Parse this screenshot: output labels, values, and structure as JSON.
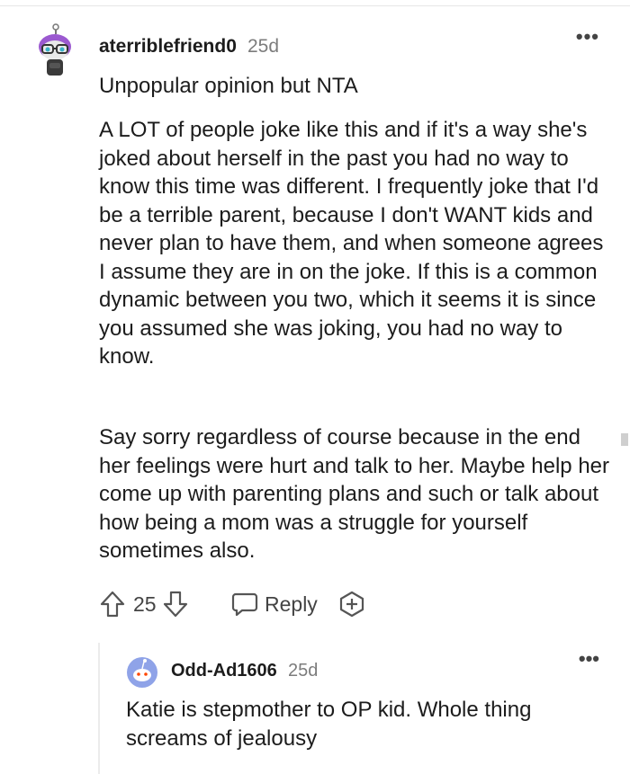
{
  "comment": {
    "username": "aterriblefriend0",
    "age": "25d",
    "more_label": "•••",
    "paragraphs": [
      "Unpopular opinion but NTA",
      "A LOT of people joke like this and if it's a way she's joked about herself in the past you had no way to know this time was different. I frequently joke that I'd be a terrible parent, because I don't WANT kids and never plan to have them, and when someone agrees I assume they are in on the joke. If this is a common dynamic between you two, which it seems it is since you assumed she was joking, you had no way to know.",
      "Say sorry regardless of course because in the end her feelings were hurt and talk to her. Maybe help her come up with parenting plans and such or talk about how being a mom was a struggle for yourself sometimes also."
    ],
    "votes": "25",
    "reply_label": "Reply",
    "icons": [
      "upvote-icon",
      "downvote-icon",
      "reply-bubble-icon",
      "award-icon"
    ]
  },
  "reply": {
    "username": "Odd-Ad1606",
    "age": "25d",
    "more_label": "•••",
    "text": "Katie is stepmother to OP kid. Whole thing screams of jealousy"
  },
  "colors": {
    "text": "#1c1c1c",
    "meta": "#7c7c7c",
    "icon": "#555555",
    "reply_avatar_bg": "#8fa3e8",
    "avatar_accent": "#9b59d0"
  }
}
